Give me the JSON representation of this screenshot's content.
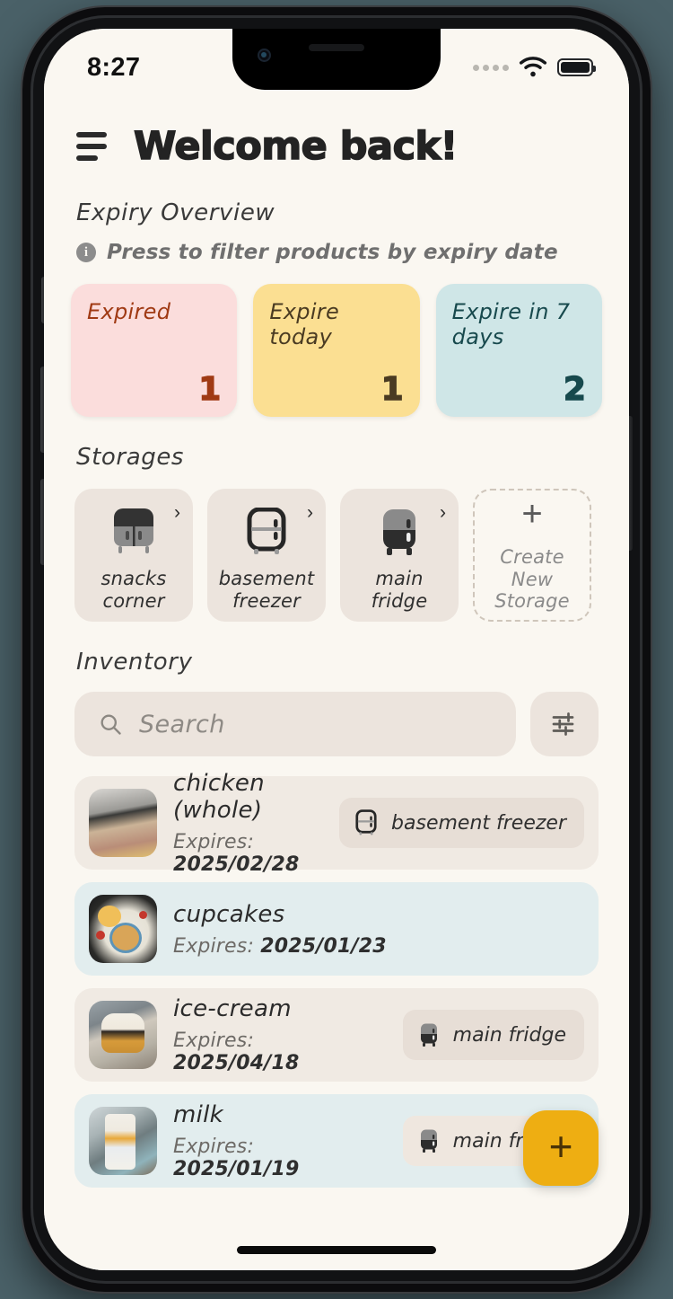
{
  "status_bar": {
    "time": "8:27",
    "signal_icon": "signal-dots-icon",
    "wifi_icon": "wifi-icon",
    "battery_icon": "battery-icon"
  },
  "header": {
    "menu_icon": "hamburger-menu-icon",
    "title": "Welcome back!"
  },
  "expiry_overview": {
    "section_title": "Expiry Overview",
    "hint_icon": "info-icon",
    "hint_text": "Press to filter products by expiry date",
    "cards": [
      {
        "label": "Expired",
        "count": "1",
        "bg": "#fbdddc",
        "fg": "#a03a14"
      },
      {
        "label": "Expire today",
        "count": "1",
        "bg": "#fbdf92",
        "fg": "#4a3b22"
      },
      {
        "label": "Expire in 7 days",
        "count": "2",
        "bg": "#cfe6e7",
        "fg": "#17494d"
      }
    ]
  },
  "storages": {
    "section_title": "Storages",
    "chevron_icon": "chevron-right-icon",
    "items": [
      {
        "name": "snacks corner",
        "icon": "cabinet-icon"
      },
      {
        "name": "basement freezer",
        "icon": "fridge-outline-icon"
      },
      {
        "name": "main fridge",
        "icon": "fridge-filled-icon"
      }
    ],
    "create": {
      "label": "Create New Storage",
      "icon": "plus-icon"
    }
  },
  "inventory": {
    "section_title": "Inventory",
    "search": {
      "placeholder": "Search",
      "value": "",
      "icon": "search-icon"
    },
    "filter_button_icon": "filter-sliders-icon",
    "expires_label": "Expires:",
    "items": [
      {
        "name": "chicken (whole)",
        "expires": "2025/02/28",
        "storage": "basement freezer",
        "storage_icon": "fridge-outline-icon",
        "highlighted": false,
        "thumb": "raw-chicken-photo"
      },
      {
        "name": "cupcakes",
        "expires": "2025/01/23",
        "storage": "",
        "storage_icon": "",
        "highlighted": true,
        "thumb": "cupcakes-plate-photo"
      },
      {
        "name": "ice-cream",
        "expires": "2025/04/18",
        "storage": "main fridge",
        "storage_icon": "fridge-filled-icon",
        "highlighted": false,
        "thumb": "ice-cream-tub-photo"
      },
      {
        "name": "milk",
        "expires": "2025/01/19",
        "storage": "main fridge",
        "storage_icon": "fridge-filled-icon",
        "highlighted": true,
        "thumb": "milk-carton-photo"
      }
    ]
  },
  "fab": {
    "icon": "plus-icon",
    "label": "+"
  }
}
